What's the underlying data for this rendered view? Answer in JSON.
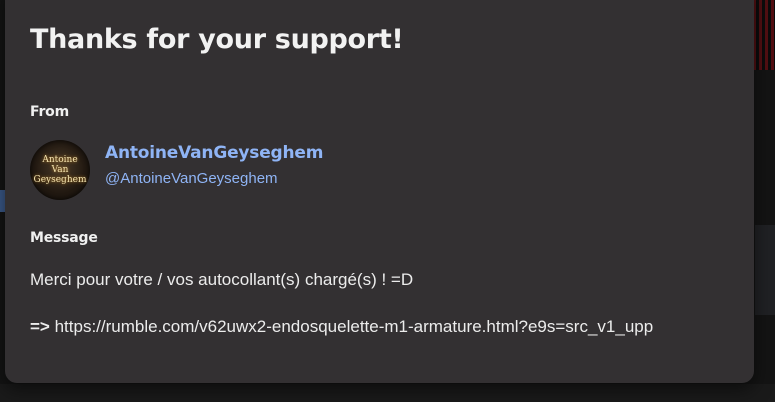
{
  "dialog": {
    "title": "Thanks for your support!",
    "from_label": "From",
    "message_label": "Message"
  },
  "sender": {
    "display_name": "AntoineVanGeyseghem",
    "handle": "@AntoineVanGeyseghem",
    "avatar_text": [
      "Antoine",
      "Van",
      "Geyseghem"
    ],
    "name_color": "#8fb4f5"
  },
  "message": {
    "line1": "Merci pour votre / vos autocollant(s) chargé(s) ! =D",
    "line2_prefix": "=>",
    "line2_link": "https://rumble.com/v62uwx2-endosquelette-m1-armature.html?e9s=src_v1_upp"
  },
  "colors": {
    "modal_background": "#333032",
    "text": "#ececec"
  }
}
